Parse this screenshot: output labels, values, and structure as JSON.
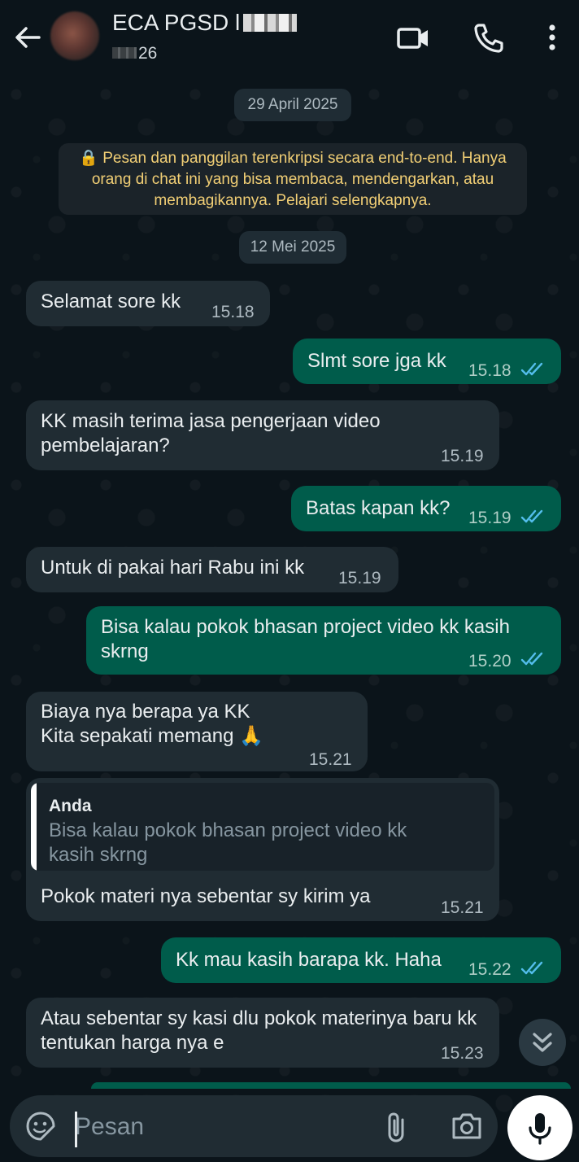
{
  "header": {
    "title": "ECA PGSD l",
    "subtitle": "26",
    "icons": {
      "back": "back-arrow-icon",
      "video": "video-call-icon",
      "call": "phone-icon",
      "menu": "more-vert-icon"
    }
  },
  "chat": {
    "date_chips": [
      "29 April 2025",
      "12 Mei 2025"
    ],
    "encryption_notice": "🔒 Pesan dan panggilan terenkripsi secara end-to-end. Hanya orang di chat ini yang bisa membaca, mendengarkan, atau membagikannya. Pelajari selengkapnya.",
    "messages": [
      {
        "dir": "in",
        "text": "Selamat sore kk",
        "time": "15.18"
      },
      {
        "dir": "out",
        "text": "Slmt sore jga kk",
        "time": "15.18",
        "read": true
      },
      {
        "dir": "in",
        "text": "KK masih terima jasa pengerjaan video pembelajaran?",
        "time": "15.19"
      },
      {
        "dir": "out",
        "text": "Batas kapan kk?",
        "time": "15.19",
        "read": true
      },
      {
        "dir": "in",
        "text": "Untuk di pakai hari Rabu ini kk",
        "time": "15.19"
      },
      {
        "dir": "out",
        "text": "Bisa kalau pokok bhasan project video kk kasih skrng",
        "time": "15.20",
        "read": true
      },
      {
        "dir": "in",
        "text": "Biaya nya berapa ya KK\nKita sepakati memang 🙏",
        "time": "15.21"
      },
      {
        "dir": "in",
        "quote_author": "Anda",
        "quote_text": "Bisa kalau pokok bhasan project video kk kasih skrng",
        "text": "Pokok materi nya sebentar sy kirim ya",
        "time": "15.21"
      },
      {
        "dir": "out",
        "text": "Kk mau kasih barapa kk. Haha",
        "time": "15.22",
        "read": true
      },
      {
        "dir": "in",
        "text": "Atau sebentar sy kasi dlu pokok materinya baru kk tentukan harga nya e",
        "time": "15.23"
      }
    ],
    "scroll_button_icon": "double-chevron-down-icon"
  },
  "composer": {
    "placeholder": "Pesan",
    "icons": {
      "emoji": "emoji-sticker-icon",
      "attach": "paperclip-icon",
      "camera": "camera-icon",
      "mic": "microphone-icon"
    }
  },
  "colors": {
    "background": "#0b141a",
    "incoming_bubble": "#202c33",
    "outgoing_bubble": "#005c4b",
    "read_ticks": "#53bdeb",
    "encryption_text": "#f2cf75"
  }
}
